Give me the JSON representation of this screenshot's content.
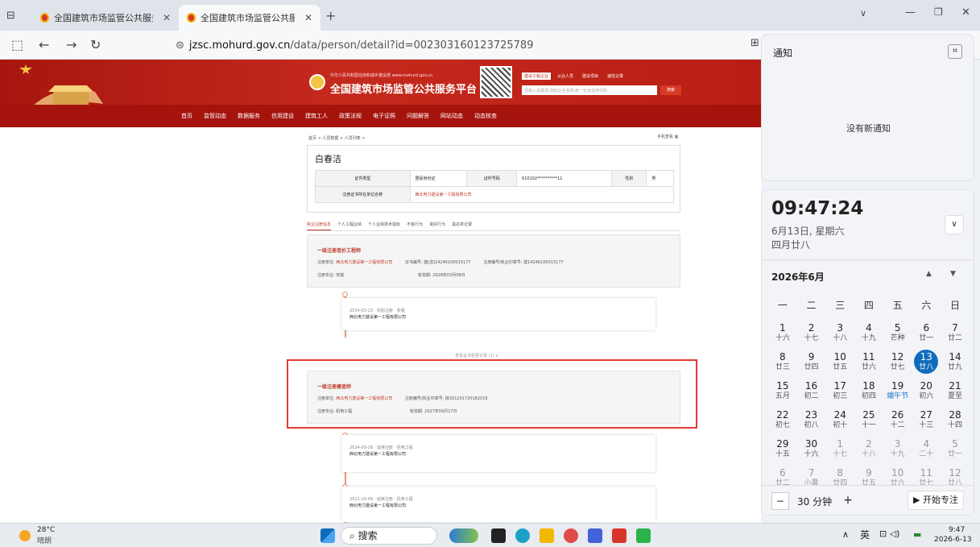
{
  "browser": {
    "tabs": [
      {
        "title": "全国建筑市场监管公共服务平台",
        "active": false
      },
      {
        "title": "全国建筑市场监管公共服务平台",
        "active": true
      }
    ],
    "url_host": "jzsc.mohurd.gov.cn",
    "url_path": "/data/person/detail?id=002303160123725789"
  },
  "site": {
    "subtitle": "中华人民共和国住房和城乡建设部 www.mohurd.gov.cn",
    "title": "全国建筑市场监管公共服务平台",
    "search_tabs": [
      "建设工程企业",
      "从业人员",
      "建设项目",
      "诚信记录"
    ],
    "search_placeholder": "请输入关键词,例如企业名称,统一社会信用代码",
    "search_button": "搜索",
    "nav": [
      "首页",
      "监管动态",
      "数据服务",
      "信用建设",
      "建筑工人",
      "政策法规",
      "电子证照",
      "问题解答",
      "网站动态",
      "动态核查"
    ]
  },
  "person": {
    "breadcrumb": "首页 > 人员数据 > 人员列表 >",
    "mobile_view": "手机查看",
    "name": "白春洁",
    "id_type_label": "证件类型",
    "id_type": "居民身份证",
    "id_no_label": "证件号码",
    "id_no": "610102**********11",
    "gender_label": "性别",
    "gender": "男",
    "unit_label": "注册证书所在单位名称",
    "unit": "西北电力建设第一工程有限公司",
    "subtabs": [
      "执业注册信息",
      "个人工程业绩",
      "个人业绩技术指标",
      "不良行为",
      "良好行为",
      "黑名单记录"
    ]
  },
  "certs": [
    {
      "title": "一级注册造价工程师",
      "unit_label": "注册单位:",
      "unit": "西北电力建设第一工程有限公司",
      "no_label": "证书编号: 建[造]14246100015177",
      "stamp_label": "注册编号/执业印章号: 建14246100015177",
      "major_label": "注册专业:",
      "major": "安装",
      "valid_label": "有效期: 2028年03月08日",
      "records": [
        {
          "date": "2024-03-23 · 初始注册 · 安装",
          "company": "西北电力建设第一工程有限公司"
        }
      ],
      "more": "查看证书变更记录 (1) ∧"
    },
    {
      "title": "一级注册建造师",
      "unit_label": "注册单位:",
      "unit": "西北电力建设第一工程有限公司",
      "stamp_label": "注册编号/执业印章号: 陕161201720182016",
      "major_label": "注册专业:",
      "major": "机电工程",
      "valid_label": "有效期: 2027年09月17日",
      "records": [
        {
          "date": "2024-09-18 · 延续注册 · 机电工程",
          "company": "西北电力建设第一工程有限公司"
        },
        {
          "date": "2021-10-09 · 延续注册 · 机电工程",
          "company": "西北电力建设第一工程有限公司"
        }
      ]
    }
  ],
  "notifications": {
    "title": "通知",
    "empty": "没有新通知"
  },
  "calendar": {
    "time": "09:47:24",
    "date_line": "6月13日, 星期六",
    "lunar_line": "四月廿八",
    "month": "2026年6月",
    "weekdays": [
      "一",
      "二",
      "三",
      "四",
      "五",
      "六",
      "日"
    ],
    "weeks": [
      [
        [
          "1",
          "十六",
          ""
        ],
        [
          "2",
          "十七",
          ""
        ],
        [
          "3",
          "十八",
          ""
        ],
        [
          "4",
          "十九",
          ""
        ],
        [
          "5",
          "芒种",
          ""
        ],
        [
          "6",
          "廿一",
          ""
        ],
        [
          "7",
          "廿二",
          ""
        ]
      ],
      [
        [
          "8",
          "廿三",
          ""
        ],
        [
          "9",
          "廿四",
          ""
        ],
        [
          "10",
          "廿五",
          ""
        ],
        [
          "11",
          "廿六",
          ""
        ],
        [
          "12",
          "廿七",
          ""
        ],
        [
          "13",
          "廿八",
          "today"
        ],
        [
          "14",
          "廿九",
          ""
        ]
      ],
      [
        [
          "15",
          "五月",
          ""
        ],
        [
          "16",
          "初二",
          ""
        ],
        [
          "17",
          "初三",
          ""
        ],
        [
          "18",
          "初四",
          ""
        ],
        [
          "19",
          "端午节",
          "fest"
        ],
        [
          "20",
          "初六",
          ""
        ],
        [
          "21",
          "夏至",
          ""
        ]
      ],
      [
        [
          "22",
          "初七",
          ""
        ],
        [
          "23",
          "初八",
          ""
        ],
        [
          "24",
          "初十",
          ""
        ],
        [
          "25",
          "十一",
          ""
        ],
        [
          "26",
          "十二",
          ""
        ],
        [
          "27",
          "十三",
          ""
        ],
        [
          "28",
          "十四",
          ""
        ]
      ],
      [
        [
          "29",
          "十五",
          ""
        ],
        [
          "30",
          "十六",
          ""
        ],
        [
          "1",
          "十七",
          "dim"
        ],
        [
          "2",
          "十八",
          "dim"
        ],
        [
          "3",
          "十九",
          "dim"
        ],
        [
          "4",
          "二十",
          "dim"
        ],
        [
          "5",
          "廿一",
          "dim"
        ]
      ],
      [
        [
          "6",
          "廿二",
          "dim"
        ],
        [
          "7",
          "小暑",
          "dim"
        ],
        [
          "8",
          "廿四",
          "dim"
        ],
        [
          "9",
          "廿五",
          "dim"
        ],
        [
          "10",
          "廿六",
          "dim"
        ],
        [
          "11",
          "廿七",
          "dim"
        ],
        [
          "12",
          "廿八",
          "dim"
        ]
      ]
    ],
    "focus_minutes": "30 分钟",
    "focus_button": "▶ 开始专注"
  },
  "taskbar": {
    "weather_temp": "28°C",
    "weather_desc": "晴朗",
    "search": "搜索",
    "ime": "英",
    "clock_time": "9:47",
    "clock_date": "2026-6-13"
  }
}
